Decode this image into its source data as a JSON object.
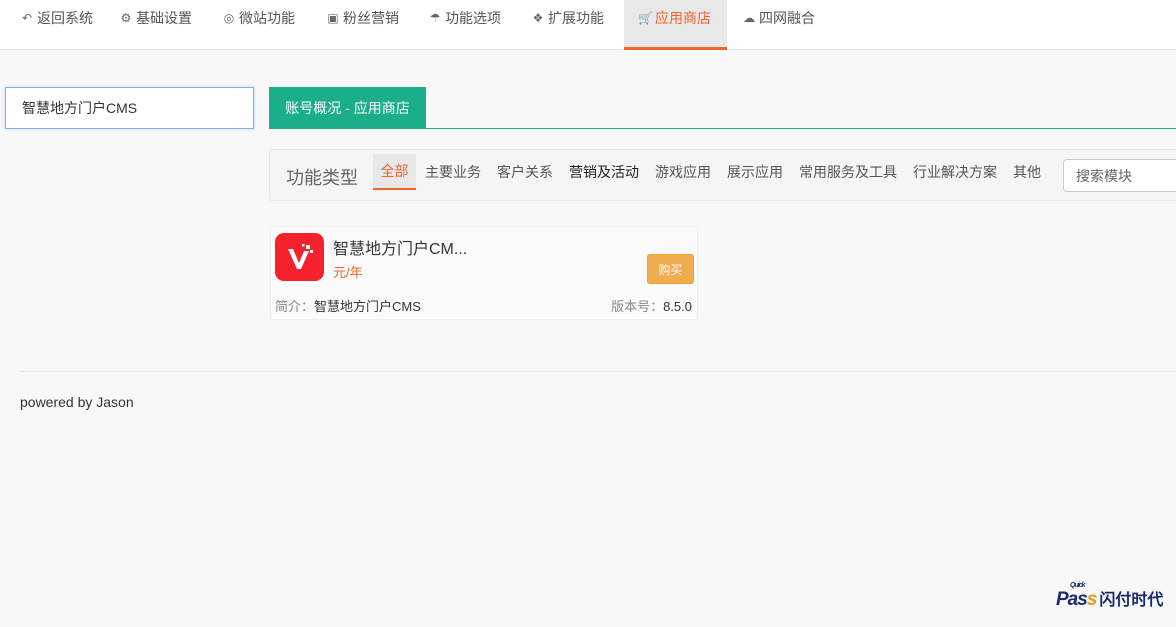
{
  "nav": {
    "items": [
      {
        "label": "返回系统",
        "icon": "reply-icon"
      },
      {
        "label": "基础设置",
        "icon": "gear-icon"
      },
      {
        "label": "微站功能",
        "icon": "lifebuoy-icon"
      },
      {
        "label": "粉丝营销",
        "icon": "gift-icon"
      },
      {
        "label": "功能选项",
        "icon": "umbrella-icon"
      },
      {
        "label": "扩展功能",
        "icon": "cubes-icon"
      },
      {
        "label": "应用商店",
        "icon": "cart-icon"
      },
      {
        "label": "四网融合",
        "icon": "cloud-upload-icon"
      }
    ],
    "active": "应用商店"
  },
  "sidebar_search": {
    "value": "智慧地方门户CMS"
  },
  "panel": {
    "tab_label": "账号概况 - 应用商店"
  },
  "filter": {
    "title": "功能类型",
    "tabs": [
      "全部",
      "主要业务",
      "客户关系",
      "营销及活动",
      "游戏应用",
      "展示应用",
      "常用服务及工具",
      "行业解决方案",
      "其他"
    ],
    "active": "全部",
    "search_placeholder": "搜索模块"
  },
  "apps": [
    {
      "name": "智慧地方门户CM...",
      "price": "元/年",
      "buy_label": "购买",
      "intro_label": "简介：",
      "intro": "智慧地方门户CMS",
      "version_label": "版本号：",
      "version": "8.5.0",
      "logo_letter": "V",
      "logo_color": "#f5222d"
    }
  ],
  "footer": {
    "text": "powered by Jason"
  },
  "watermark": {
    "quick": "Quick",
    "pass_main": "Pas",
    "pass_tail": "s",
    "cn": "闪付时代"
  },
  "colors": {
    "accent": "#f0642a",
    "teal": "#1aae8a",
    "buy": "#f0ad4e"
  }
}
